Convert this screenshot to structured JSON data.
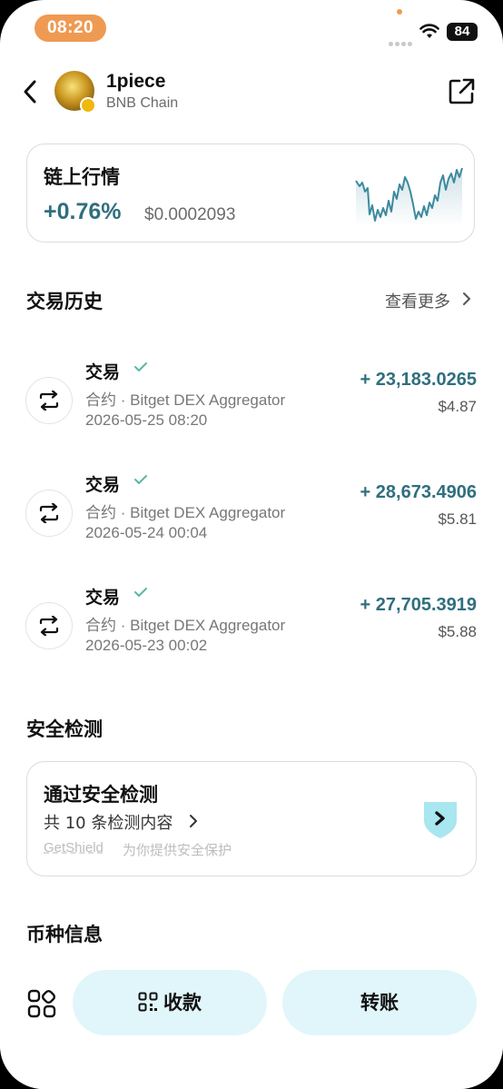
{
  "status_bar": {
    "time": "08:20",
    "battery": "84"
  },
  "header": {
    "token_name": "1piece",
    "chain": "BNB Chain"
  },
  "market": {
    "title": "链上行情",
    "change": "+0.76%",
    "price": "$0.0002093",
    "line_color": "#3d8a9e"
  },
  "history": {
    "title": "交易历史",
    "see_more": "查看更多",
    "items": [
      {
        "type": "交易",
        "contract": "合约 · Bitget DEX Aggregator",
        "date": "2026-05-25 08:20",
        "amount": "+ 23,183.0265",
        "usd": "$4.87"
      },
      {
        "type": "交易",
        "contract": "合约 · Bitget DEX Aggregator",
        "date": "2026-05-24 00:04",
        "amount": "+ 28,673.4906",
        "usd": "$5.81"
      },
      {
        "type": "交易",
        "contract": "合约 · Bitget DEX Aggregator",
        "date": "2026-05-23 00:02",
        "amount": "+ 27,705.3919",
        "usd": "$5.88"
      }
    ]
  },
  "security": {
    "title": "安全检测",
    "card_title": "通过安全检测",
    "count_text": "共 10 条检测内容",
    "provider": "GetShield",
    "provider_text": "为你提供安全保护",
    "shield_color": "#a8e6f0"
  },
  "coin_info": {
    "title": "币种信息"
  },
  "bottom": {
    "receive_label": "收款",
    "transfer_label": "转账",
    "button_color": "#e1f6fa"
  },
  "colors": {
    "accent": "#2f6f7e",
    "status_pill": "#ef9a52"
  }
}
